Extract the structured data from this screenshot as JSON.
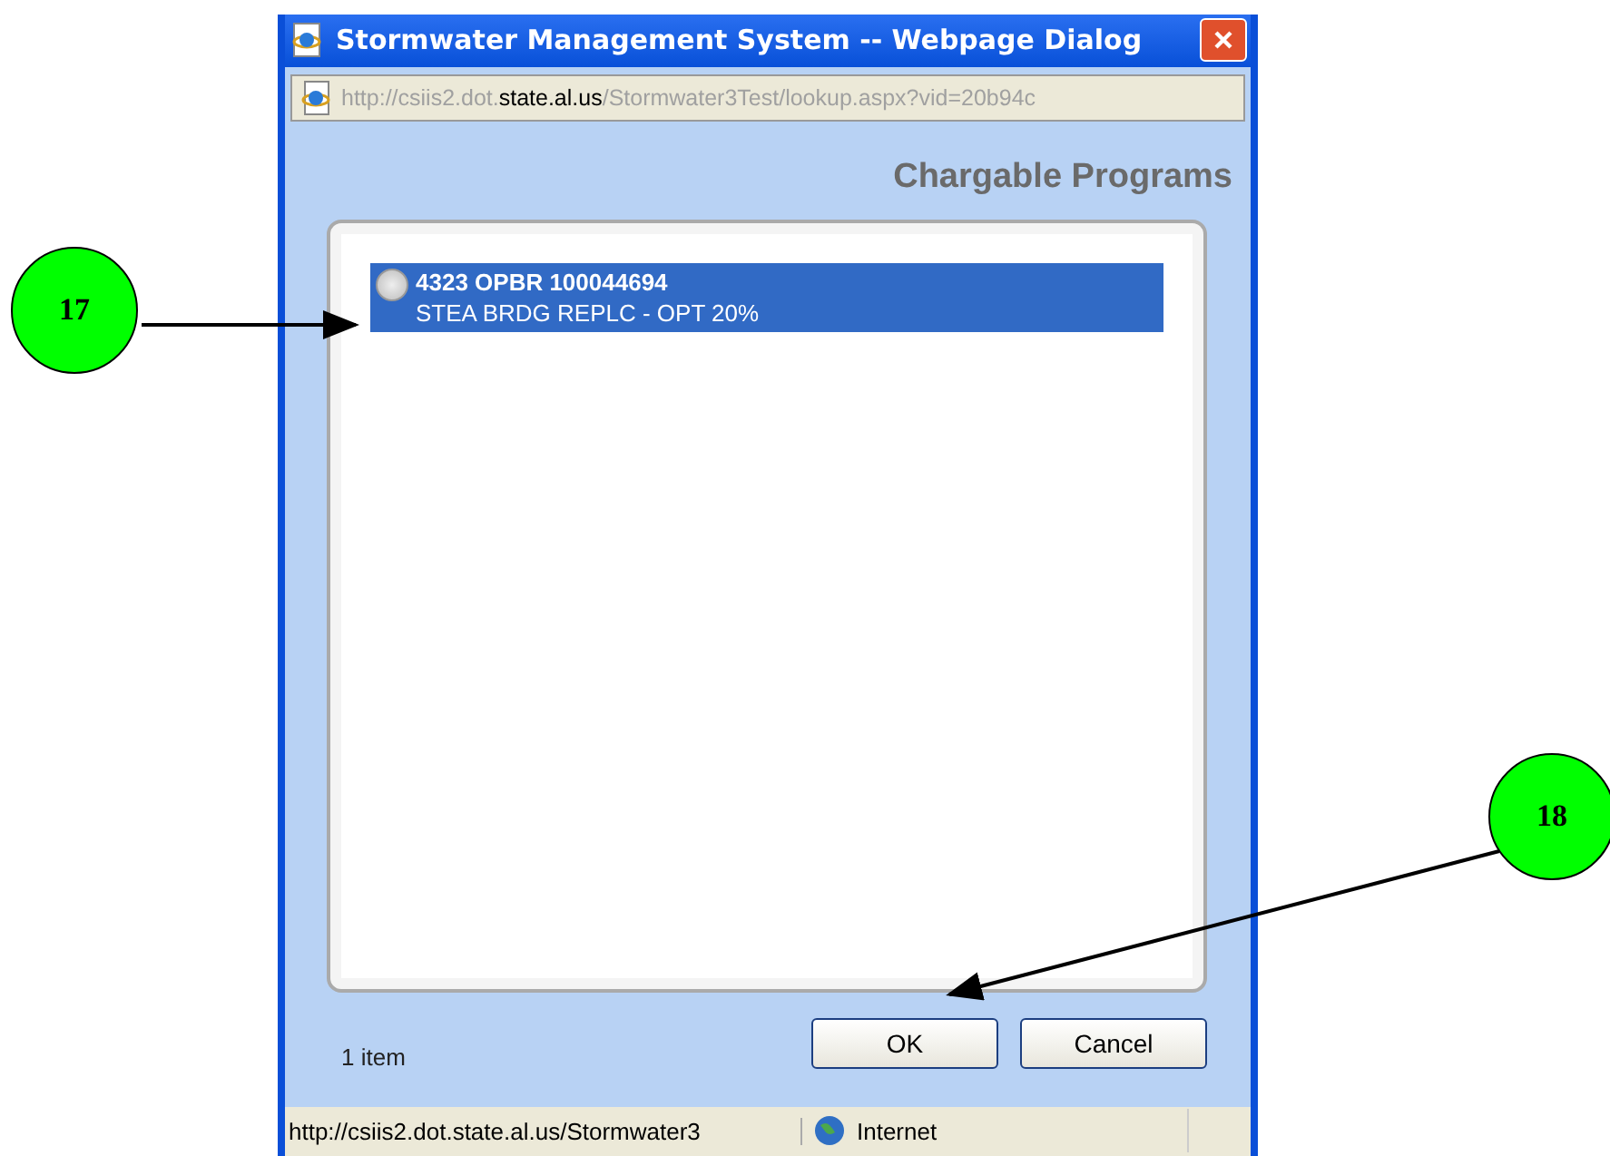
{
  "window": {
    "title": "Stormwater Management System -- Webpage Dialog"
  },
  "address": {
    "before": "http://csiis2.dot.",
    "domain": "state.al.us",
    "after": "/Stormwater3Test/lookup.aspx?vid=20b94c"
  },
  "heading": "Chargable Programs",
  "items": [
    {
      "code": "4323 OPBR 100044694",
      "description": "STEA BRDG REPLC - OPT 20%",
      "selected": true,
      "checked": false
    }
  ],
  "count": "1 item",
  "buttons": [
    "OK",
    "Cancel"
  ],
  "status_bar": {
    "url": "http://csiis2.dot.state.al.us/Stormwater3",
    "zone": "Internet"
  },
  "callouts": [
    {
      "label": "17"
    },
    {
      "label": "18"
    }
  ]
}
